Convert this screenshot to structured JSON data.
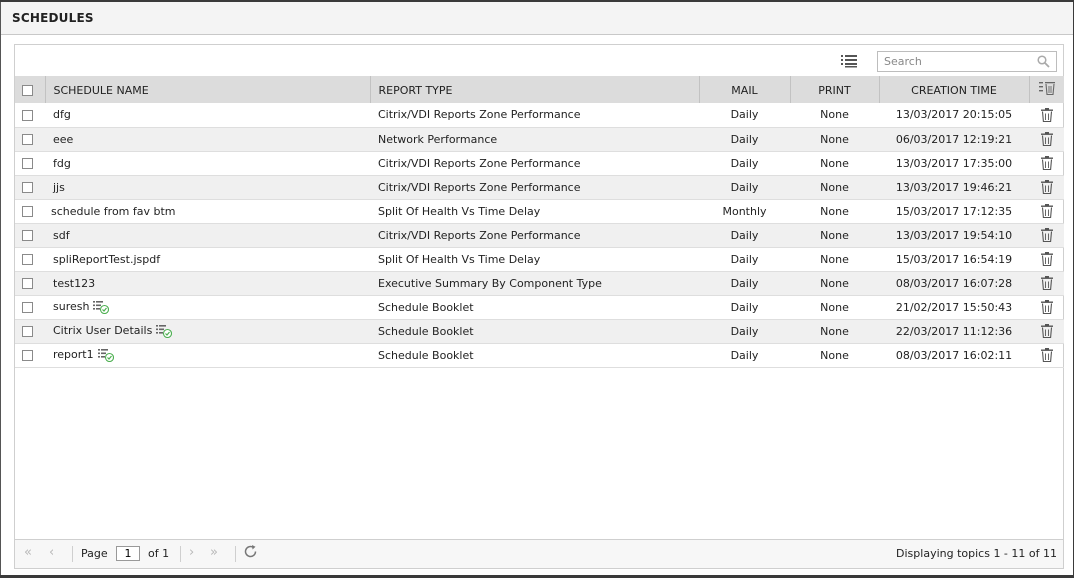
{
  "window": {
    "title": "SCHEDULES"
  },
  "search": {
    "placeholder": "Search"
  },
  "columns": [
    "SCHEDULE NAME",
    "REPORT TYPE",
    "MAIL",
    "PRINT",
    "CREATION TIME"
  ],
  "rows": [
    {
      "name": "dfg",
      "report_type": "Citrix/VDI Reports Zone Performance",
      "mail": "Daily",
      "print": "None",
      "created": "13/03/2017 20:15:05",
      "booklet": false
    },
    {
      "name": "eee",
      "report_type": "Network Performance",
      "mail": "Daily",
      "print": "None",
      "created": "06/03/2017 12:19:21",
      "booklet": false
    },
    {
      "name": "fdg",
      "report_type": "Citrix/VDI Reports Zone Performance",
      "mail": "Daily",
      "print": "None",
      "created": "13/03/2017 17:35:00",
      "booklet": false
    },
    {
      "name": "jjs",
      "report_type": "Citrix/VDI Reports Zone Performance",
      "mail": "Daily",
      "print": "None",
      "created": "13/03/2017 19:46:21",
      "booklet": false
    },
    {
      "name": "schedule from fav btm",
      "report_type": "Split Of Health Vs Time Delay",
      "mail": "Monthly",
      "print": "None",
      "created": "15/03/2017 17:12:35",
      "booklet": false
    },
    {
      "name": "sdf",
      "report_type": "Citrix/VDI Reports Zone Performance",
      "mail": "Daily",
      "print": "None",
      "created": "13/03/2017 19:54:10",
      "booklet": false
    },
    {
      "name": "spliReportTest.jspdf",
      "report_type": "Split Of Health Vs Time Delay",
      "mail": "Daily",
      "print": "None",
      "created": "15/03/2017 16:54:19",
      "booklet": false
    },
    {
      "name": "test123",
      "report_type": "Executive Summary By Component Type",
      "mail": "Daily",
      "print": "None",
      "created": "08/03/2017 16:07:28",
      "booklet": false
    },
    {
      "name": "suresh",
      "report_type": "Schedule Booklet",
      "mail": "Daily",
      "print": "None",
      "created": "21/02/2017 15:50:43",
      "booklet": true
    },
    {
      "name": "Citrix User Details",
      "report_type": "Schedule Booklet",
      "mail": "Daily",
      "print": "None",
      "created": "22/03/2017 11:12:36",
      "booklet": true
    },
    {
      "name": "report1",
      "report_type": "Schedule Booklet",
      "mail": "Daily",
      "print": "None",
      "created": "08/03/2017 16:02:11",
      "booklet": true
    }
  ],
  "pager": {
    "page_label": "Page",
    "page_value": "1",
    "of_label": "of 1",
    "summary": "Displaying topics 1 - 11 of 11"
  },
  "icons": {
    "list_view": "list-view-icon",
    "search": "search-icon",
    "delete": "trash-icon",
    "booklet": "booklet-icon",
    "first": "first-page-icon",
    "prev": "prev-page-icon",
    "next": "next-page-icon",
    "last": "last-page-icon",
    "refresh": "refresh-icon"
  },
  "colors": {
    "header_bg": "#dcdcdc",
    "alt_row": "#f0f0f0",
    "booklet_check": "#4caf50"
  }
}
